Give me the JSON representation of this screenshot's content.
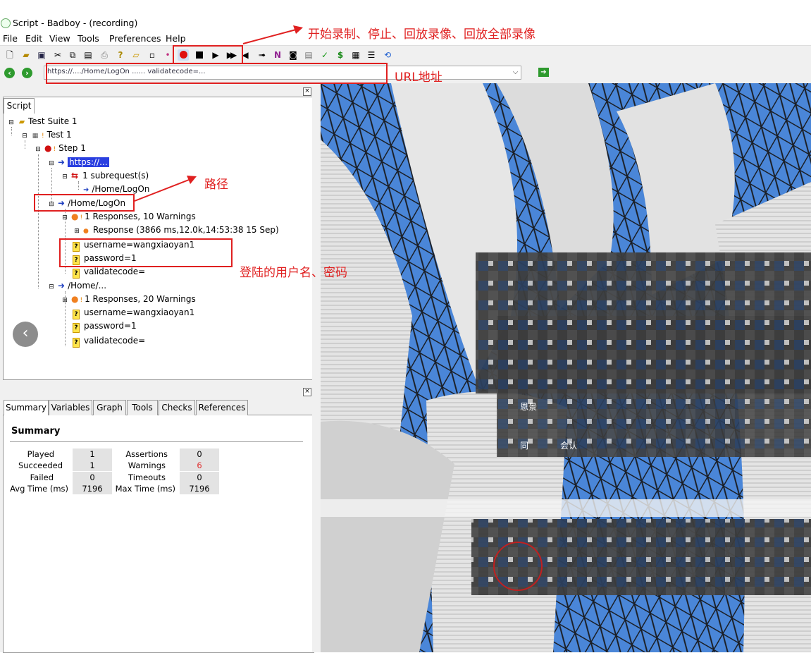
{
  "window": {
    "title": "Script - Badboy - (recording)"
  },
  "menu": [
    "File",
    "Edit",
    "View",
    "Tools",
    "Preferences",
    "Help"
  ],
  "toolbar": {
    "icons": [
      "new-icon",
      "open-icon",
      "save-icon",
      "cut-icon",
      "copy-icon",
      "paste-icon",
      "print-icon",
      "help-icon",
      "folder-add-icon",
      "step-add-icon",
      "record-icon",
      "stop-icon",
      "play-icon",
      "play-all-icon",
      "rewind-icon",
      "navigate-icon",
      "n-icon",
      "camera-icon",
      "report-icon",
      "check-icon",
      "dollar-icon",
      "table-icon",
      "tree-icon",
      "refresh-icon"
    ]
  },
  "address": {
    "value": "https://..../Home/LogOn ...... validatecode=..."
  },
  "script_panel": {
    "tab": "Script",
    "tree": {
      "suite": "Test Suite 1",
      "test": "Test 1",
      "step": "Step 1",
      "req1": "https://...",
      "subreq": "1 subrequest(s)",
      "subreq_item": "/Home/LogOn",
      "req2": "/Home/LogOn",
      "resp2": "1 Responses, 10 Warnings",
      "resp2_item": "Response (3866 ms,12.0k,14:53:38 15 Sep)",
      "p_user": "username=wangxiaoyan1",
      "p_pass": "password=1",
      "p_code": "validatecode=",
      "req3": "/Home/...",
      "resp3": "1 Responses, 20 Warnings",
      "p3_user": "username=wangxiaoyan1",
      "p3_pass": "password=1",
      "p3_code": "validatecode="
    }
  },
  "bottom_panel": {
    "tabs": [
      "Summary",
      "Variables",
      "Graph",
      "Tools",
      "Checks",
      "References"
    ],
    "summary": {
      "title": "Summary",
      "played_label": "Played",
      "played": "1",
      "succeeded_label": "Succeeded",
      "succeeded": "1",
      "failed_label": "Failed",
      "failed": "0",
      "avg_label": "Avg Time (ms)",
      "avg": "7196",
      "assertions_label": "Assertions",
      "assertions": "0",
      "warnings_label": "Warnings",
      "warnings": "6",
      "timeouts_label": "Timeouts",
      "timeouts": "0",
      "max_label": "Max Time (ms)",
      "max": "7196"
    }
  },
  "browser_overlay": {
    "line1": "恩景",
    "line2": "同",
    "line3": "会认"
  },
  "annotations": {
    "record_controls": "开始录制、停止、回放录像、回放全部录像",
    "url": "URL地址",
    "path": "路径",
    "credentials": "登陆的用户名、密码"
  },
  "colors": {
    "annotation": "#e02020",
    "selection": "#2a3fe0",
    "warning_value": "#e03030"
  }
}
